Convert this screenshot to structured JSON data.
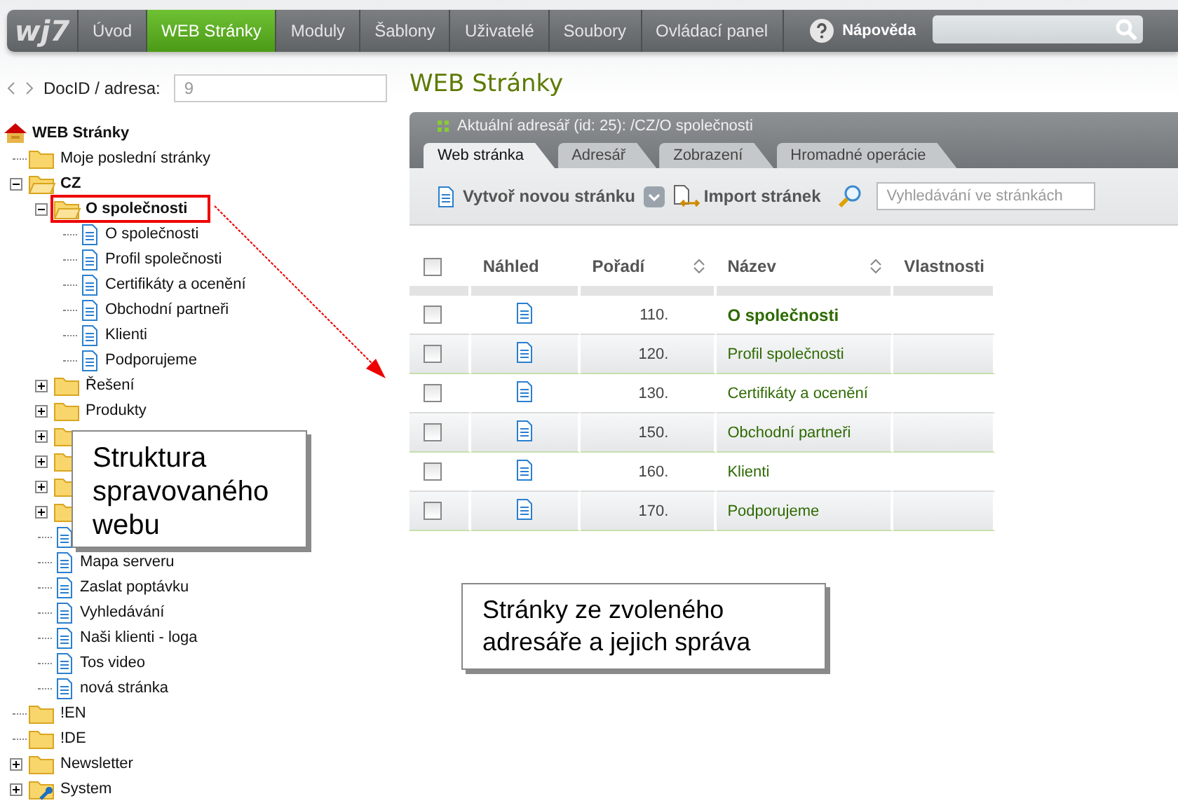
{
  "nav": {
    "logo": "wj7",
    "items": [
      {
        "label": "Úvod",
        "selected": false
      },
      {
        "label": "WEB Stránky",
        "selected": true
      },
      {
        "label": "Moduly",
        "selected": false
      },
      {
        "label": "Šablony",
        "selected": false
      },
      {
        "label": "Uživatelé",
        "selected": false
      },
      {
        "label": "Soubory",
        "selected": false
      },
      {
        "label": "Ovládací panel",
        "selected": false
      }
    ],
    "help": "Nápověda"
  },
  "address": {
    "label": "DocID / adresa:",
    "value": "9"
  },
  "tree": [
    {
      "kind": "root",
      "label": "WEB Stránky",
      "bold": true,
      "children": [
        {
          "kind": "folder",
          "label": "Moje poslední stránky",
          "bold": false
        },
        {
          "kind": "folder",
          "label": "CZ",
          "bold": true,
          "expanded": true,
          "children": [
            {
              "kind": "folder",
              "label": "O společnosti",
              "bold": true,
              "expanded": true,
              "highlighted": true,
              "children": [
                {
                  "kind": "page",
                  "label": "O společnosti",
                  "bold": false
                },
                {
                  "kind": "page",
                  "label": "Profil společnosti",
                  "bold": false
                },
                {
                  "kind": "page",
                  "label": "Certifikáty a ocenění",
                  "bold": false
                },
                {
                  "kind": "page",
                  "label": "Obchodní partneři",
                  "bold": false
                },
                {
                  "kind": "page",
                  "label": "Klienti",
                  "bold": false
                },
                {
                  "kind": "page",
                  "label": "Podporujeme",
                  "bold": false
                }
              ]
            },
            {
              "kind": "folder",
              "label": "Řešení",
              "bold": false,
              "expanded": false
            },
            {
              "kind": "folder",
              "label": "Produkty",
              "bold": false,
              "expanded": false
            },
            {
              "kind": "folder",
              "expanded": false
            },
            {
              "kind": "folder",
              "expanded": false
            },
            {
              "kind": "folder",
              "expanded": false
            },
            {
              "kind": "folder",
              "expanded": false
            },
            {
              "kind": "page"
            },
            {
              "kind": "page",
              "label": "Mapa serveru",
              "bold": false
            },
            {
              "kind": "page",
              "label": "Zaslat poptávku",
              "bold": false
            },
            {
              "kind": "page",
              "label": "Vyhledávání",
              "bold": false
            },
            {
              "kind": "page",
              "label": "Naši klienti - loga",
              "bold": false
            },
            {
              "kind": "page",
              "label": "Tos video",
              "bold": false
            },
            {
              "kind": "page",
              "label": "nová stránka",
              "bold": false
            }
          ]
        },
        {
          "kind": "folder",
          "label": "!EN",
          "bold": false
        },
        {
          "kind": "folder",
          "label": "!DE",
          "bold": false
        },
        {
          "kind": "folder",
          "label": "Newsletter",
          "bold": false,
          "expanded": false
        },
        {
          "kind": "system",
          "label": "System",
          "bold": false,
          "expanded": false
        }
      ]
    }
  ],
  "main": {
    "title": "WEB Stránky",
    "path": "Aktuální adresář (id: 25): /CZ/O společnosti",
    "tabs": [
      {
        "label": "Web stránka",
        "selected": true
      },
      {
        "label": "Adresář",
        "selected": false
      },
      {
        "label": "Zobrazení",
        "selected": false
      },
      {
        "label": "Hromadné operácie",
        "selected": false
      }
    ],
    "toolbar": {
      "create": "Vytvoř novou stránku",
      "import": "Import stránek",
      "search_placeholder": "Vyhledávání ve stránkách"
    },
    "table": {
      "all_checked": false,
      "columns": [
        {
          "label": "Náhled",
          "sortable": false
        },
        {
          "label": "Pořadí",
          "sortable": true
        },
        {
          "label": "Název",
          "sortable": true
        },
        {
          "label": "Vlastnosti",
          "sortable": false
        }
      ],
      "rows": [
        {
          "checked": false,
          "order": "110.",
          "name": "O společnosti",
          "current": true
        },
        {
          "checked": false,
          "order": "120.",
          "name": "Profil společnosti",
          "current": false
        },
        {
          "checked": false,
          "order": "130.",
          "name": "Certifikáty a ocenění",
          "current": false
        },
        {
          "checked": false,
          "order": "150.",
          "name": "Obchodní partneři",
          "current": false
        },
        {
          "checked": false,
          "order": "160.",
          "name": "Klienti",
          "current": false
        },
        {
          "checked": false,
          "order": "170.",
          "name": "Podporujeme",
          "current": false
        }
      ]
    }
  },
  "callouts": [
    {
      "text": "Struktura spravovaného webu"
    },
    {
      "text": "Stránky ze zvoleného adresáře a jejich správa"
    }
  ]
}
